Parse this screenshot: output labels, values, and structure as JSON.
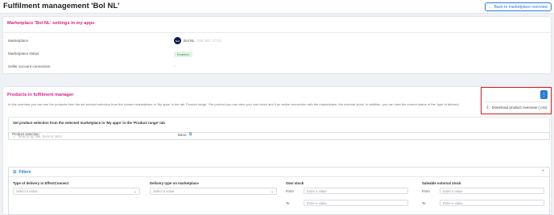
{
  "header": {
    "title": "Fulfilment management 'Bol NL'",
    "back_button": "Back to marketplace overview"
  },
  "marketplace_card": {
    "title": "Marketplace 'Bol NL' settings in my apps",
    "rows": [
      {
        "label": "Marketplace",
        "value": "Bol NL",
        "sub": "(NS 201 1771)"
      },
      {
        "label": "Marketplace status",
        "value": "Enabled"
      },
      {
        "label": "Seller account connection",
        "value": "-"
      }
    ]
  },
  "products_card": {
    "title": "Products in fulfilment manager",
    "description": "In this overview you can see the products from the set product selection from the chosen marketplace in 'My apps' in the tab 'Product range'. Per product you can view your own stock and if an active connection with the marketplace, the external stock. In addition, you can view the current status of the 'type of delivery'.",
    "menu": {
      "kebab": "⋮",
      "download": "Download product overview (.csv)"
    },
    "selection": {
      "title": "Set product selection from the selected marketplace in 'My apps' in the 'Product range' tab",
      "label": "Product selection",
      "value": "Basic"
    },
    "search_placeholder": "Search by title, EAN or SKU",
    "filters": {
      "title": "Filters",
      "delivery_type_ec": {
        "label": "Type of delivery in EffectConnect",
        "placeholder": "Select a value"
      },
      "delivery_type_mp": {
        "label": "Delivery type on marketplace",
        "placeholder": "Select a value"
      },
      "own_stock": {
        "label": "Own stock",
        "from": "From",
        "to": "To",
        "placeholder": "Enter a value"
      },
      "external_stock": {
        "label": "Saleable external stock",
        "from": "From",
        "to": "To",
        "placeholder": "Enter a value"
      }
    }
  },
  "colors": {
    "accent": "#2b7bd6",
    "section_title": "#d6238a",
    "highlight": "#cc1f1f",
    "enabled_badge": "#3a9a4e"
  }
}
